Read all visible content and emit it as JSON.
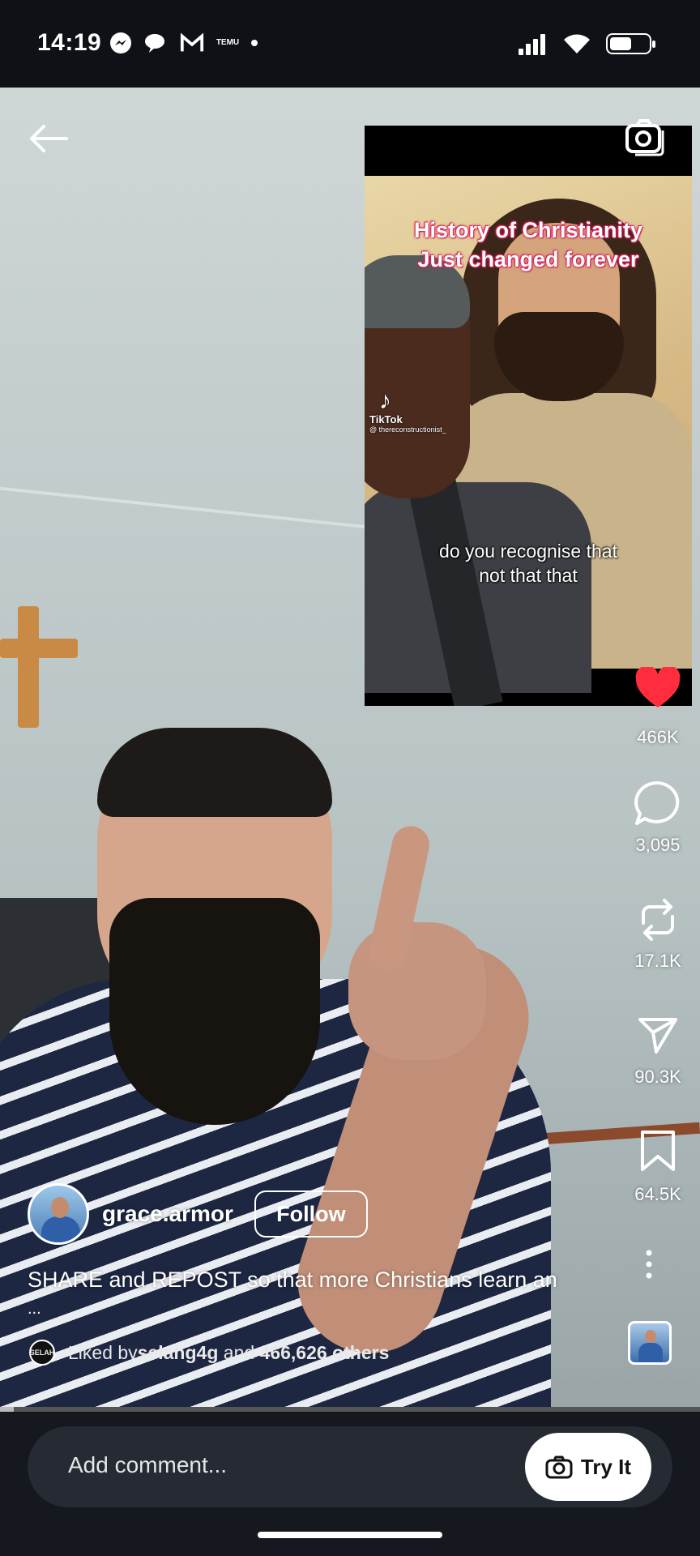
{
  "status_bar": {
    "time": "14:19",
    "left_icons": [
      "messenger-icon",
      "chat-bubbles-icon",
      "gmail-icon",
      "temu-icon",
      "dot-icon"
    ],
    "temu_label": "TEMU",
    "right_icons": [
      "signal-icon",
      "wifi-icon",
      "battery-icon"
    ]
  },
  "inset_video": {
    "title_line1": "History of Christianity",
    "title_line2": "Just changed forever",
    "subtitle_line1": "do you recognise that",
    "subtitle_line2": "not that that",
    "watermark": "TikTok",
    "watermark_handle": "@ thereconstructionist_"
  },
  "actions": {
    "likes": "466K",
    "comments": "3,095",
    "reposts": "17.1K",
    "shares": "90.3K",
    "saves": "64.5K"
  },
  "post": {
    "username": "grace.armor",
    "follow_label": "Follow",
    "caption": "SHARE and REPOST so that more Christians learn an",
    "caption_more": "...",
    "liked_prefix": "Liked by ",
    "liked_user": "selahg4g",
    "liked_middle": " and ",
    "liked_count": "466,626 others",
    "liked_avatar_text": "SELAH"
  },
  "progress": 0.02,
  "comment_bar": {
    "placeholder": "Add comment...",
    "try_label": "Try It"
  },
  "colors": {
    "heart": "#ff2d3d",
    "caption_outline": "#d6235a",
    "background": "#111318"
  }
}
